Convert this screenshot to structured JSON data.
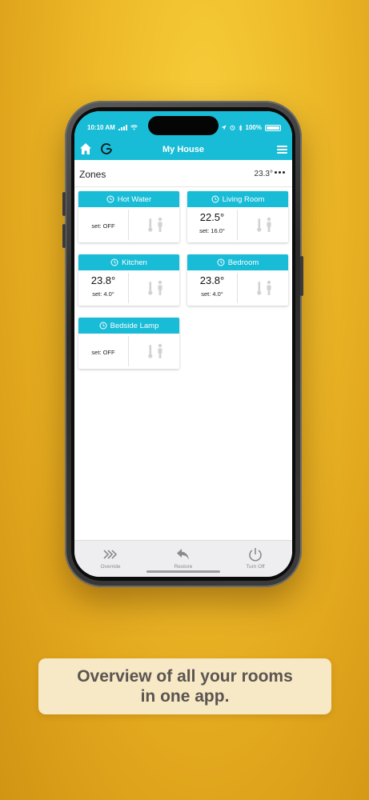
{
  "status_bar": {
    "time": "10:10 AM",
    "battery": "100%"
  },
  "header": {
    "title": "My House"
  },
  "zones": {
    "title": "Zones",
    "temperature": "23.3°",
    "items": [
      {
        "name": "Hot Water",
        "current": "",
        "set": "set: OFF"
      },
      {
        "name": "Living Room",
        "current": "22.5°",
        "set": "set: 16.0°"
      },
      {
        "name": "Kitchen",
        "current": "23.8°",
        "set": "set: 4.0°"
      },
      {
        "name": "Bedroom",
        "current": "23.8°",
        "set": "set: 4.0°"
      },
      {
        "name": "Bedside Lamp",
        "current": "",
        "set": "set: OFF"
      }
    ]
  },
  "bottom_bar": {
    "override": "Override",
    "restore": "Restore",
    "turn_off": "Turn Off"
  },
  "caption": {
    "line1": "Overview of all your rooms",
    "line2": "in one app."
  },
  "colors": {
    "accent": "#18bcd6",
    "background": "#eebb2a",
    "caption_bg": "#f7e8c6"
  }
}
